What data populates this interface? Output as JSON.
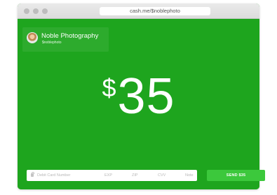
{
  "browser": {
    "url": "cash.me/$noblephoto"
  },
  "profile": {
    "name": "Noble Photography",
    "handle": "$noblephoto"
  },
  "amount": {
    "currency_symbol": "$",
    "value": "35"
  },
  "payment_form": {
    "card_number_placeholder": "Debit Card Number",
    "exp_placeholder": "EXP",
    "zip_placeholder": "ZIP",
    "cvv_placeholder": "CVV",
    "note_placeholder": "Note",
    "send_label": "SEND $35"
  },
  "colors": {
    "background_green": "#1ea51e",
    "button_green": "#3cc83c"
  }
}
